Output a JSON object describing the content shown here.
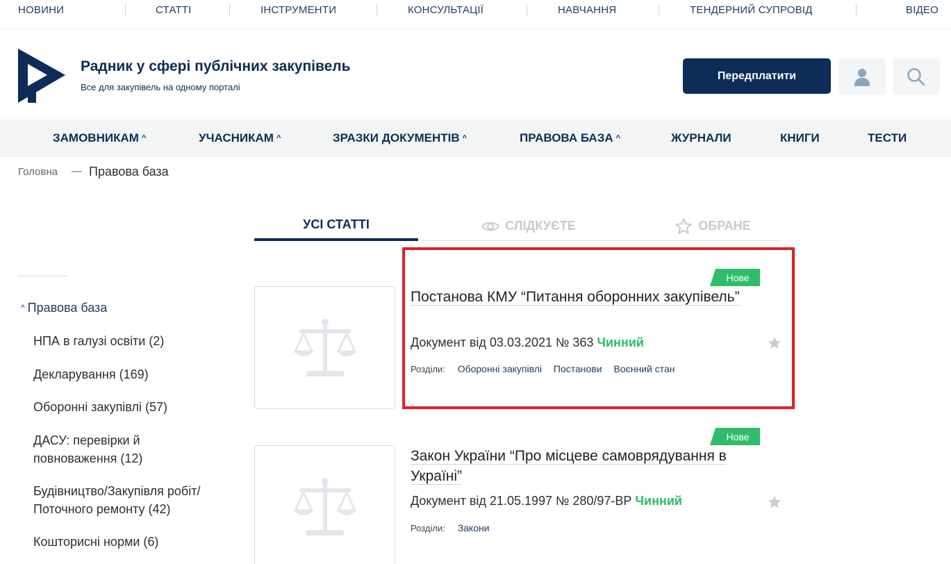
{
  "topnav": [
    "НОВИНИ",
    "СТАТТІ",
    "ІНСТРУМЕНТИ",
    "КОНСУЛЬТАЦІЇ",
    "НАВЧАННЯ",
    "ТЕНДЕРНИЙ СУПРОВІД",
    "ВІДЕО"
  ],
  "header": {
    "title": "Радник у сфері публічних закупівель",
    "subtitle": "Все для закупівель на одному порталі",
    "subscribe_label": "Передплатити",
    "user_icon": "user-icon",
    "search_icon": "search-icon"
  },
  "mainnav": [
    {
      "label": "ЗАМОВНИКАМ",
      "has_dropdown": true
    },
    {
      "label": "УЧАСНИКАМ",
      "has_dropdown": true
    },
    {
      "label": "ЗРАЗКИ ДОКУМЕНТІВ",
      "has_dropdown": true
    },
    {
      "label": "ПРАВОВА БАЗА",
      "has_dropdown": true
    },
    {
      "label": "ЖУРНАЛИ",
      "has_dropdown": false
    },
    {
      "label": "КНИГИ",
      "has_dropdown": false
    },
    {
      "label": "ТЕСТИ",
      "has_dropdown": false
    }
  ],
  "breadcrumb": {
    "home": "Головна",
    "separator": "—",
    "current": "Правова база"
  },
  "tabs": [
    {
      "label": "УСІ СТАТТІ",
      "active": true
    },
    {
      "label": "СЛІДКУЄТЕ",
      "active": false,
      "icon": "eye-icon"
    },
    {
      "label": "ОБРАНЕ",
      "active": false,
      "icon": "star-icon"
    }
  ],
  "sidebar": {
    "heading": "Правова база",
    "items": [
      "НПА в галузі освіти (2)",
      "Декларування (169)",
      "Оборонні закупівлі (57)",
      "ДАСУ: перевірки й повноваження (12)",
      "Будівництво/Закупівля робіт/ Поточного ремонту (42)",
      "Кошторисні норми (6)"
    ]
  },
  "articles": [
    {
      "badge": "Нове",
      "title": "Постанова КМУ “Питання оборонних закупівель”",
      "doc_prefix": "Документ від 03.03.2021 № 363",
      "status": "Чинний",
      "sections_label": "Розділи:",
      "sections": [
        "Оборонні закупівлі",
        "Постанови",
        "Воєнний стан"
      ],
      "highlighted": true
    },
    {
      "badge": "Нове",
      "title": "Закон України “Про місцеве самоврядування в Україні”",
      "doc_prefix": "Документ від 21.05.1997 № 280/97-ВР",
      "status": "Чинний",
      "sections_label": "Розділи:",
      "sections": [
        "Закони"
      ],
      "highlighted": false
    }
  ],
  "colors": {
    "brand": "#0d2d58",
    "status_green": "#2fbd6b",
    "highlight_red": "#e0202a"
  }
}
